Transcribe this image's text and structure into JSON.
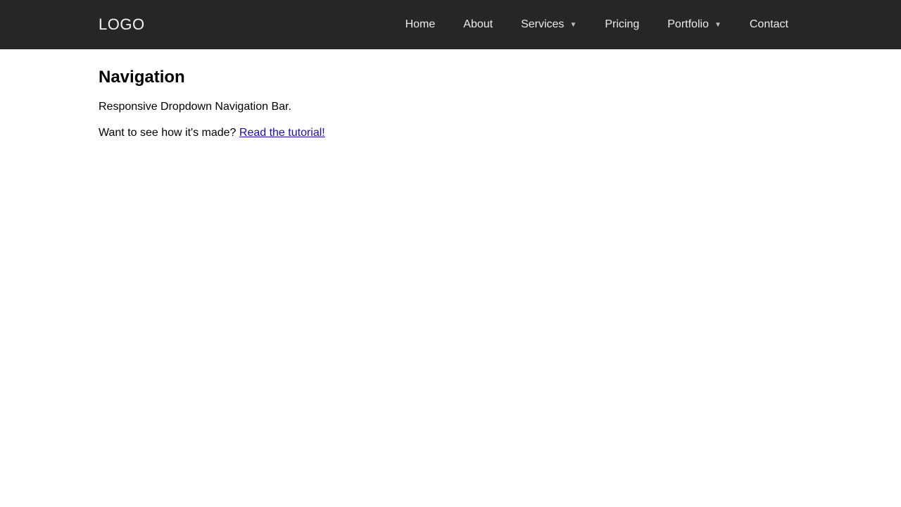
{
  "header": {
    "logo": "LOGO",
    "menu": [
      {
        "label": "Home",
        "has_dropdown": false
      },
      {
        "label": "About",
        "has_dropdown": false
      },
      {
        "label": "Services",
        "has_dropdown": true
      },
      {
        "label": "Pricing",
        "has_dropdown": false
      },
      {
        "label": "Portfolio",
        "has_dropdown": true
      },
      {
        "label": "Contact",
        "has_dropdown": false
      }
    ]
  },
  "main": {
    "heading": "Navigation",
    "description": "Responsive Dropdown Navigation Bar.",
    "cta_prefix": "Want to see how it's made? ",
    "cta_link_text": "Read the tutorial!"
  },
  "colors": {
    "navbar_bg": "#262626",
    "nav_text": "#ececec",
    "link": "#1a0dab"
  }
}
